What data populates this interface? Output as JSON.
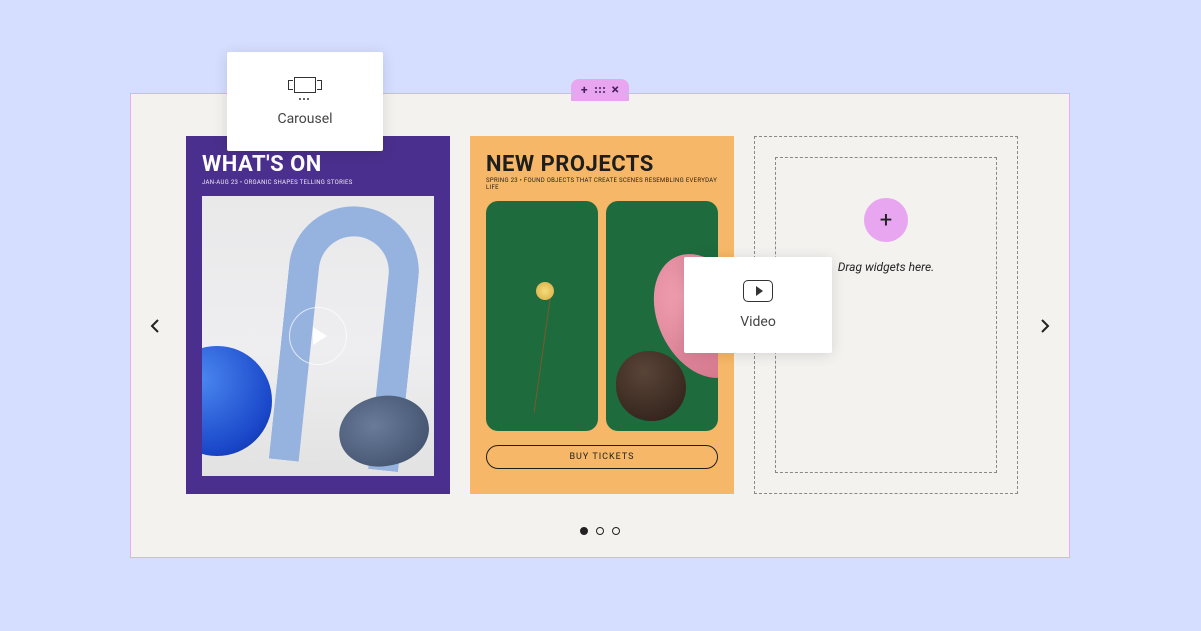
{
  "widgets": {
    "carousel_label": "Carousel",
    "video_label": "Video"
  },
  "editor": {
    "dropzone_hint": "Drag widgets here."
  },
  "cards": [
    {
      "title": "WHAT'S ON",
      "subtitle": "JAN-AUG 23 • ORGANIC SHAPES TELLING STORIES"
    },
    {
      "title": "NEW PROJECTS",
      "subtitle": "SPRING 23 • FOUND OBJECTS THAT CREATE SCENES RESEMBLING EVERYDAY LIFE",
      "cta": "BUY TICKETS"
    }
  ],
  "pagination": {
    "active_index": 0,
    "count": 3
  },
  "colors": {
    "page_bg": "#d6deff",
    "canvas_bg": "#f3f2ef",
    "canvas_border": "#e9aaf0",
    "accent_pink": "#e8a5f0",
    "card1_bg": "#4b2f8e",
    "card2_bg": "#f6b868",
    "media_green": "#1e6b3e"
  }
}
